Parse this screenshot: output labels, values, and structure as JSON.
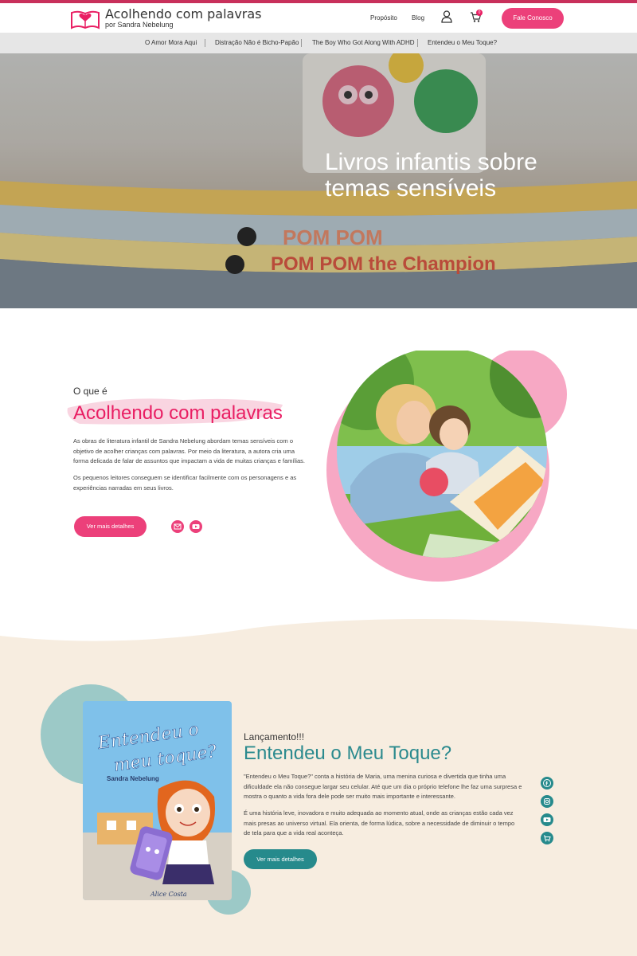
{
  "header": {
    "logo_title": "Acolhendo com palavras",
    "logo_subtitle": "por Sandra Nebelung",
    "nav": [
      "Propósito",
      "Blog"
    ],
    "cart_count": "0",
    "contact_button": "Fale Conosco"
  },
  "subnav": {
    "items": [
      "O Amor Mora Aqui",
      "Distração Não é Bicho-Papão",
      "The Boy Who Got Along With ADHD",
      "Entendeu o Meu Toque?"
    ]
  },
  "hero": {
    "title": "Livros infantis sobre temas sensíveis",
    "book_spine_text": "POM POM",
    "book_spine_text_2": "POM POM the Champion"
  },
  "about": {
    "kicker": "O que é",
    "title": "Acolhendo com palavras",
    "p1": "As obras de literatura infantil de Sandra Nebelung abordam temas sensíveis com o objetivo de acolher crianças com palavras. Por meio da literatura, a autora cria uma forma delicada de falar de assuntos que impactam a vida de muitas crianças e famílias.",
    "p2": "Os pequenos leitores  conseguem se identificar facilmente com os personagens e as experiências narradas em seus livros.",
    "button": "Ver mais detalhes"
  },
  "release": {
    "kicker": "Lançamento!!!",
    "title": "Entendeu o Meu Toque?",
    "p1": "\"Entendeu o Meu Toque?\" conta a história de Maria, uma menina curiosa e divertida que tinha uma dificuldade ela não consegue largar seu celular. Até que um dia o próprio telefone lhe faz uma surpresa e mostra o quanto a vida fora dele pode ser muito mais importante e interessante.",
    "p2": "É uma história leve, inovadora e muito adequada ao momento atual, onde as crianças estão cada vez mais presas ao universo virtual. Ela orienta, de forma lúdica, sobre a necessidade de diminuir o tempo de tela para que a vida real aconteça.",
    "button": "Ver mais detalhes",
    "cover_title_line1": "Entendeu o",
    "cover_title_line2": "meu toque?",
    "cover_author": "Sandra Nebelung",
    "cover_illustrator": "Alice Costa"
  },
  "colors": {
    "brand_pink": "#ec407a",
    "accent_teal": "#268a8c",
    "cream": "#f7ede0"
  }
}
